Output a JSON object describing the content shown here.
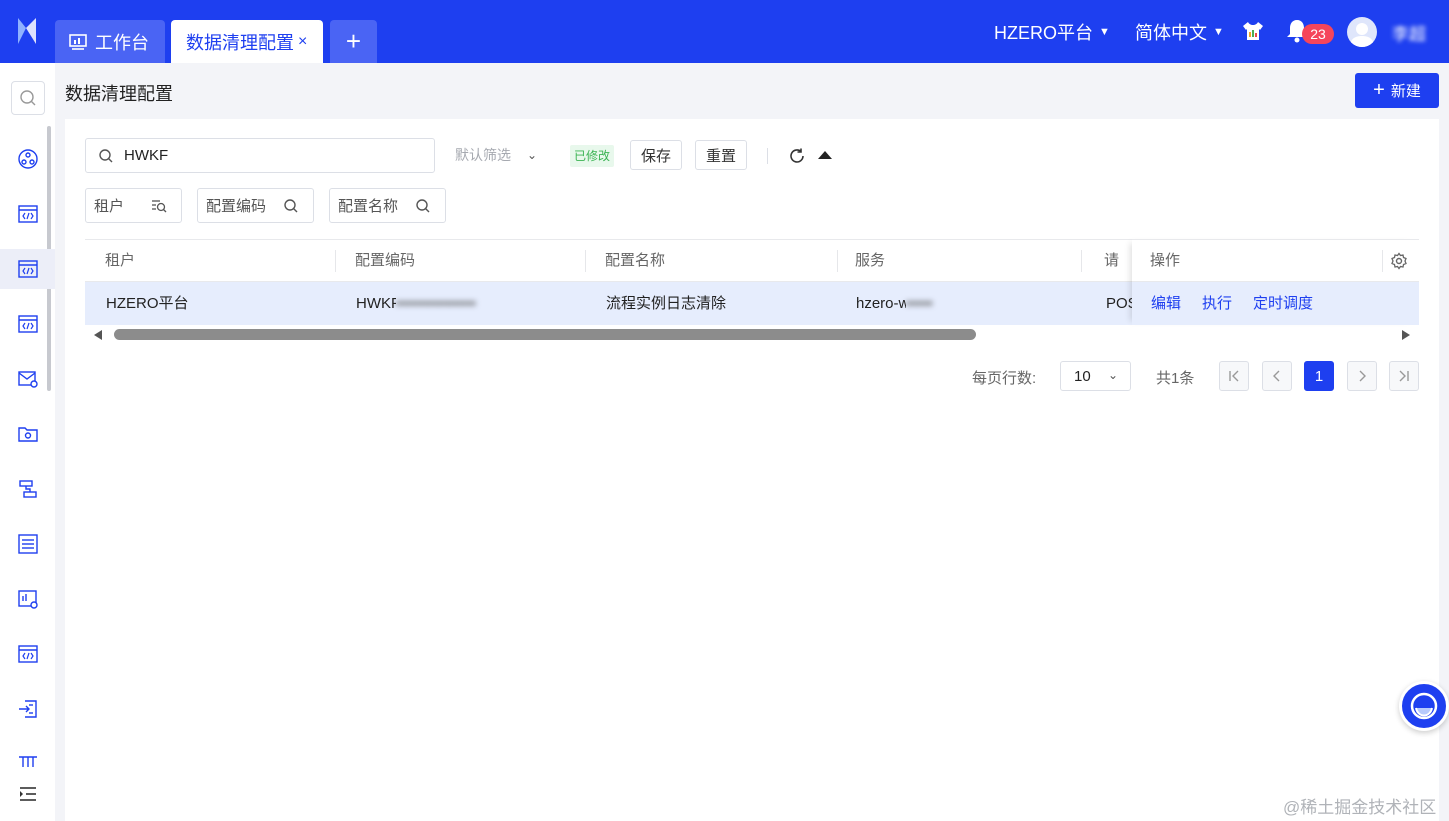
{
  "header": {
    "tabs": [
      {
        "label": "工作台"
      },
      {
        "label": "数据清理配置",
        "close": "×"
      },
      {
        "label": "+"
      }
    ],
    "platform": "HZERO平台",
    "language": "简体中文",
    "notification_count": "23",
    "username": "李超"
  },
  "page": {
    "title": "数据清理配置",
    "new_button": "新建"
  },
  "toolbar": {
    "search_value": "HWKF",
    "filter_placeholder": "默认筛选",
    "modified_tag": "已修改",
    "save_label": "保存",
    "reset_label": "重置"
  },
  "filters": {
    "tenant": "租户",
    "config_code": "配置编码",
    "config_name": "配置名称"
  },
  "table": {
    "columns": [
      "租户",
      "配置编码",
      "配置名称",
      "服务",
      "请求",
      "操作"
    ],
    "rows": [
      {
        "tenant": "HZERO平台",
        "config_code": "HWKF_INSTANCE_REV_CLR_1",
        "config_name": "流程实例日志清除",
        "service": "hzero-workflow",
        "method": "POST",
        "actions": [
          "编辑",
          "执行",
          "定时调度"
        ]
      }
    ]
  },
  "pagination": {
    "page_size_label": "每页行数:",
    "page_size": "10",
    "total": "共1条",
    "current_page": "1"
  },
  "watermark": "@稀土掘金技术社区",
  "colors": {
    "primary": "#1e3ff0",
    "row_highlight": "#e6edfd",
    "badge": "#f5455b",
    "modified_green": "#3cb454"
  }
}
